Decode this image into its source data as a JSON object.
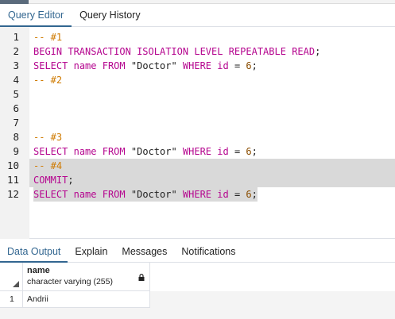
{
  "editor_tabs": [
    {
      "label": "Query Editor",
      "active": true
    },
    {
      "label": "Query History",
      "active": false
    }
  ],
  "editor_lines": [
    {
      "n": "1",
      "tokens": [
        {
          "t": "cmt",
          "v": "-- #1"
        }
      ]
    },
    {
      "n": "2",
      "tokens": [
        {
          "t": "kw",
          "v": "BEGIN"
        },
        {
          "t": "plain",
          "v": " "
        },
        {
          "t": "kw",
          "v": "TRANSACTION"
        },
        {
          "t": "plain",
          "v": " "
        },
        {
          "t": "kw",
          "v": "ISOLATION"
        },
        {
          "t": "plain",
          "v": " "
        },
        {
          "t": "kw",
          "v": "LEVEL"
        },
        {
          "t": "plain",
          "v": " "
        },
        {
          "t": "kw",
          "v": "REPEATABLE"
        },
        {
          "t": "plain",
          "v": " "
        },
        {
          "t": "kw",
          "v": "READ"
        },
        {
          "t": "plain",
          "v": ";"
        }
      ]
    },
    {
      "n": "3",
      "tokens": [
        {
          "t": "kw",
          "v": "SELECT"
        },
        {
          "t": "plain",
          "v": " "
        },
        {
          "t": "kw",
          "v": "name"
        },
        {
          "t": "plain",
          "v": " "
        },
        {
          "t": "kw",
          "v": "FROM"
        },
        {
          "t": "plain",
          "v": " "
        },
        {
          "t": "str",
          "v": "\"Doctor\""
        },
        {
          "t": "plain",
          "v": " "
        },
        {
          "t": "kw",
          "v": "WHERE"
        },
        {
          "t": "plain",
          "v": " "
        },
        {
          "t": "kw",
          "v": "id"
        },
        {
          "t": "plain",
          "v": " = "
        },
        {
          "t": "num",
          "v": "6"
        },
        {
          "t": "plain",
          "v": ";"
        }
      ]
    },
    {
      "n": "4",
      "tokens": [
        {
          "t": "cmt",
          "v": "-- #2"
        }
      ]
    },
    {
      "n": "5",
      "tokens": []
    },
    {
      "n": "6",
      "tokens": []
    },
    {
      "n": "7",
      "tokens": []
    },
    {
      "n": "8",
      "tokens": [
        {
          "t": "cmt",
          "v": "-- #3"
        }
      ]
    },
    {
      "n": "9",
      "tokens": [
        {
          "t": "kw",
          "v": "SELECT"
        },
        {
          "t": "plain",
          "v": " "
        },
        {
          "t": "kw",
          "v": "name"
        },
        {
          "t": "plain",
          "v": " "
        },
        {
          "t": "kw",
          "v": "FROM"
        },
        {
          "t": "plain",
          "v": " "
        },
        {
          "t": "str",
          "v": "\"Doctor\""
        },
        {
          "t": "plain",
          "v": " "
        },
        {
          "t": "kw",
          "v": "WHERE"
        },
        {
          "t": "plain",
          "v": " "
        },
        {
          "t": "kw",
          "v": "id"
        },
        {
          "t": "plain",
          "v": " = "
        },
        {
          "t": "num",
          "v": "6"
        },
        {
          "t": "plain",
          "v": ";"
        }
      ]
    },
    {
      "n": "10",
      "sel": "full",
      "tokens": [
        {
          "t": "cmt",
          "v": "-- #4"
        }
      ]
    },
    {
      "n": "11",
      "sel": "full",
      "tokens": [
        {
          "t": "kw",
          "v": "COMMIT"
        },
        {
          "t": "plain",
          "v": ";"
        }
      ]
    },
    {
      "n": "12",
      "sel": "part",
      "tokens": [
        {
          "t": "kw",
          "v": "SELECT"
        },
        {
          "t": "plain",
          "v": " "
        },
        {
          "t": "kw",
          "v": "name"
        },
        {
          "t": "plain",
          "v": " "
        },
        {
          "t": "kw",
          "v": "FROM"
        },
        {
          "t": "plain",
          "v": " "
        },
        {
          "t": "str",
          "v": "\"Doctor\""
        },
        {
          "t": "plain",
          "v": " "
        },
        {
          "t": "kw",
          "v": "WHERE"
        },
        {
          "t": "plain",
          "v": " "
        },
        {
          "t": "kw",
          "v": "id"
        },
        {
          "t": "plain",
          "v": " = "
        },
        {
          "t": "num",
          "v": "6"
        },
        {
          "t": "plain",
          "v": ";"
        }
      ]
    }
  ],
  "output_tabs": [
    {
      "label": "Data Output",
      "active": true
    },
    {
      "label": "Explain",
      "active": false
    },
    {
      "label": "Messages",
      "active": false
    },
    {
      "label": "Notifications",
      "active": false
    }
  ],
  "grid": {
    "column": {
      "name": "name",
      "type": "character varying (255)",
      "icon": "lock-icon"
    },
    "rows": [
      {
        "num": "1",
        "value": "Andrii"
      }
    ]
  },
  "colors": {
    "accent": "#326690",
    "keyword": "#b5068f",
    "comment": "#cf7a00",
    "number": "#8a4d00",
    "selection": "#d9d9d9"
  }
}
